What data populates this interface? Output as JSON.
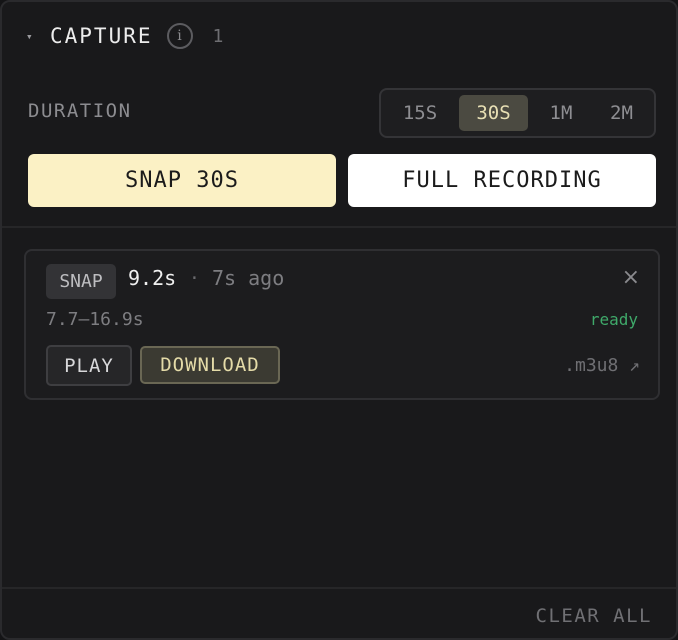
{
  "header": {
    "caret": "▾",
    "title": "CAPTURE",
    "info_glyph": "i",
    "count": "1"
  },
  "duration": {
    "label": "DURATION",
    "options": [
      "15S",
      "30S",
      "1M",
      "2M"
    ],
    "selected": "30S"
  },
  "actions": {
    "snap_label": "SNAP 30S",
    "full_label": "FULL RECORDING"
  },
  "clips": [
    {
      "tag": "SNAP",
      "duration": "9.2s",
      "separator": "·",
      "ago": "7s ago",
      "close_glyph": "×",
      "range": "7.7–16.9s",
      "status": "ready",
      "play_label": "PLAY",
      "download_label": "DOWNLOAD",
      "format_label": ".m3u8 ↗"
    }
  ],
  "footer": {
    "clear_all_label": "CLEAR ALL"
  },
  "colors": {
    "accent": "#fbf1c5",
    "status_ready": "#3fa96a",
    "background": "#19191b"
  },
  "icons": {
    "caret": "chevron-down-icon",
    "info": "info-icon",
    "close": "close-icon",
    "external": "external-link-icon"
  }
}
